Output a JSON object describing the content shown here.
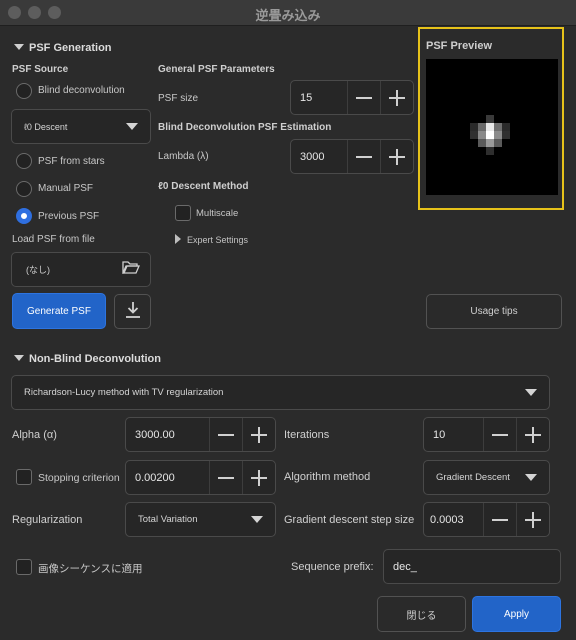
{
  "window": {
    "title": "逆畳み込み"
  },
  "psf_generation": {
    "header": "PSF Generation",
    "source_title": "PSF Source",
    "blind_deconvolution": "Blind deconvolution",
    "blind_method_select": "ℓ0 Descent",
    "psf_from_stars": "PSF from stars",
    "manual_psf": "Manual PSF",
    "previous_psf": "Previous PSF",
    "load_psf_label": "Load PSF from file",
    "file_value": "(なし)",
    "generate_button": "Generate PSF",
    "general_params_title": "General PSF Parameters",
    "psf_size_label": "PSF size",
    "psf_size_value": "15",
    "blind_estimation_title": "Blind Deconvolution PSF Estimation",
    "lambda_label": "Lambda (λ)",
    "lambda_value": "3000",
    "l0_method_title": "ℓ0 Descent Method",
    "multiscale_label": "Multiscale",
    "expert_settings": "Expert Settings",
    "preview_title": "PSF Preview",
    "usage_tips_button": "Usage tips"
  },
  "non_blind": {
    "header": "Non-Blind Deconvolution",
    "method_select": "Richardson-Lucy method with TV regularization",
    "alpha_label": "Alpha (α)",
    "alpha_value": "3000.00",
    "stopping_label": "Stopping criterion",
    "stopping_value": "0.00200",
    "regularization_label": "Regularization",
    "regularization_value": "Total Variation",
    "iterations_label": "Iterations",
    "iterations_value": "10",
    "algorithm_label": "Algorithm method",
    "algorithm_value": "Gradient Descent",
    "step_label": "Gradient descent step size",
    "step_value": "0.0003",
    "sequence_apply_label": "画像シーケンスに適用",
    "sequence_prefix_label": "Sequence prefix:",
    "sequence_prefix_value": "dec_"
  },
  "footer": {
    "close_button": "閉じる",
    "apply_button": "Apply"
  },
  "colors": {
    "accent": "#2264c8",
    "highlight": "#e6c21a",
    "background": "#2b2b2b"
  },
  "icons": {
    "folder": "folder-open-icon",
    "download": "download-icon",
    "minus": "minus-icon",
    "plus": "plus-icon"
  }
}
